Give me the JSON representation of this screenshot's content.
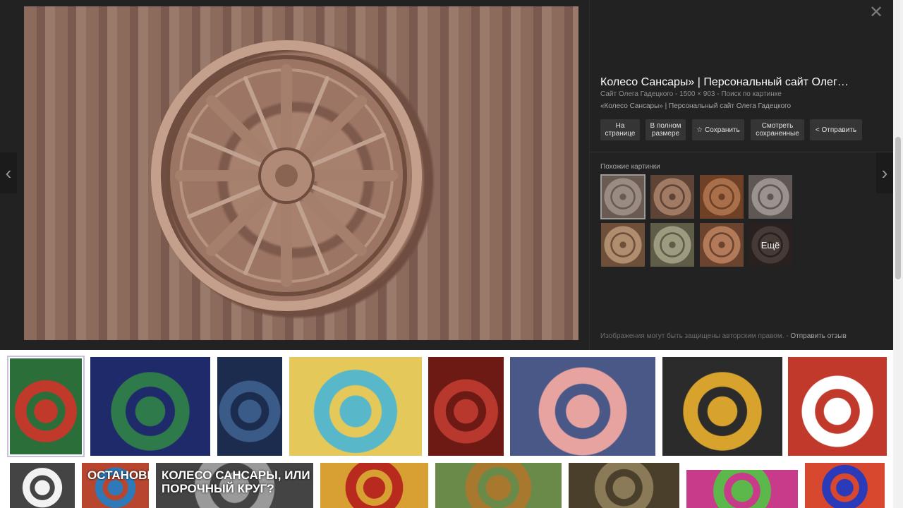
{
  "viewer": {
    "title": "Колесо Сансары» | Персональный сайт Олег…",
    "meta": "Сайт Олега Гадецкого - 1500 × 903 - Поиск по картинке",
    "description": "«Колесо Сансары» | Персональный сайт Олега Гадецкого",
    "actions": {
      "page_line1": "На",
      "page_line2": "странице",
      "full_line1": "В полном",
      "full_line2": "размере",
      "save": "☆ Сохранить",
      "saved_line1": "Смотреть",
      "saved_line2": "сохраненные",
      "share": "< Отправить"
    },
    "similar_label": "Похожие картинки",
    "more_label": "Ещё",
    "copyright": "Изображения могут быть защищены авторским правом.",
    "feedback": "Отправить отзыв",
    "close": "✕",
    "prev": "‹",
    "next": "›"
  },
  "similar_thumbs": [
    {
      "color_a": "#9a8b82",
      "color_b": "#6a5a52"
    },
    {
      "color_a": "#a07a62",
      "color_b": "#5e4436"
    },
    {
      "color_a": "#a86f4a",
      "color_b": "#6e4126"
    },
    {
      "color_a": "#9a928e",
      "color_b": "#5f5753"
    },
    {
      "color_a": "#b08d6f",
      "color_b": "#6d4f3a"
    },
    {
      "color_a": "#9d9a80",
      "color_b": "#5f5c48"
    },
    {
      "color_a": "#b27a58",
      "color_b": "#6b4430"
    },
    {
      "color_a": "#6b5a54",
      "color_b": "#3f3330"
    }
  ],
  "results_row1": [
    {
      "color_a": "#c0392b",
      "color_b": "#2c6e3a",
      "text": ""
    },
    {
      "color_a": "#2f7a4a",
      "color_b": "#1f2a6a",
      "text": ""
    },
    {
      "color_a": "#3a5a88",
      "color_b": "#1b2c4e",
      "text": ""
    },
    {
      "color_a": "#58b7c8",
      "color_b": "#e4c85a",
      "text": ""
    },
    {
      "color_a": "#b8382e",
      "color_b": "#6d1a14",
      "text": ""
    },
    {
      "color_a": "#e7a3a0",
      "color_b": "#4a5888",
      "text": ""
    },
    {
      "color_a": "#d8a32c",
      "color_b": "#2b2b2b",
      "text": ""
    },
    {
      "color_a": "#ffffff",
      "color_b": "#c0392b",
      "text": ""
    }
  ],
  "results_row2": [
    {
      "color_a": "#f2f2f2",
      "color_b": "#444444",
      "text": ""
    },
    {
      "color_a": "#2e7ab8",
      "color_b": "#b8462e",
      "text": "ОСТАНОВИТЕ"
    },
    {
      "color_a": "#9a9a9a",
      "color_b": "#444444",
      "text": "КОЛЕСО САНСАРЫ, ИЛИ ПОРОЧНЫЙ КРУГ?"
    },
    {
      "color_a": "#b8291e",
      "color_b": "#d8a032",
      "text": ""
    },
    {
      "color_a": "#a8782e",
      "color_b": "#6a8a4a",
      "text": ""
    },
    {
      "color_a": "#8a7a58",
      "color_b": "#4a3f2a",
      "text": ""
    },
    {
      "color_a": "#5cb84a",
      "color_b": "#c83a8a",
      "text": ""
    },
    {
      "color_a": "#2a3ab8",
      "color_b": "#d8482e",
      "text": ""
    }
  ]
}
